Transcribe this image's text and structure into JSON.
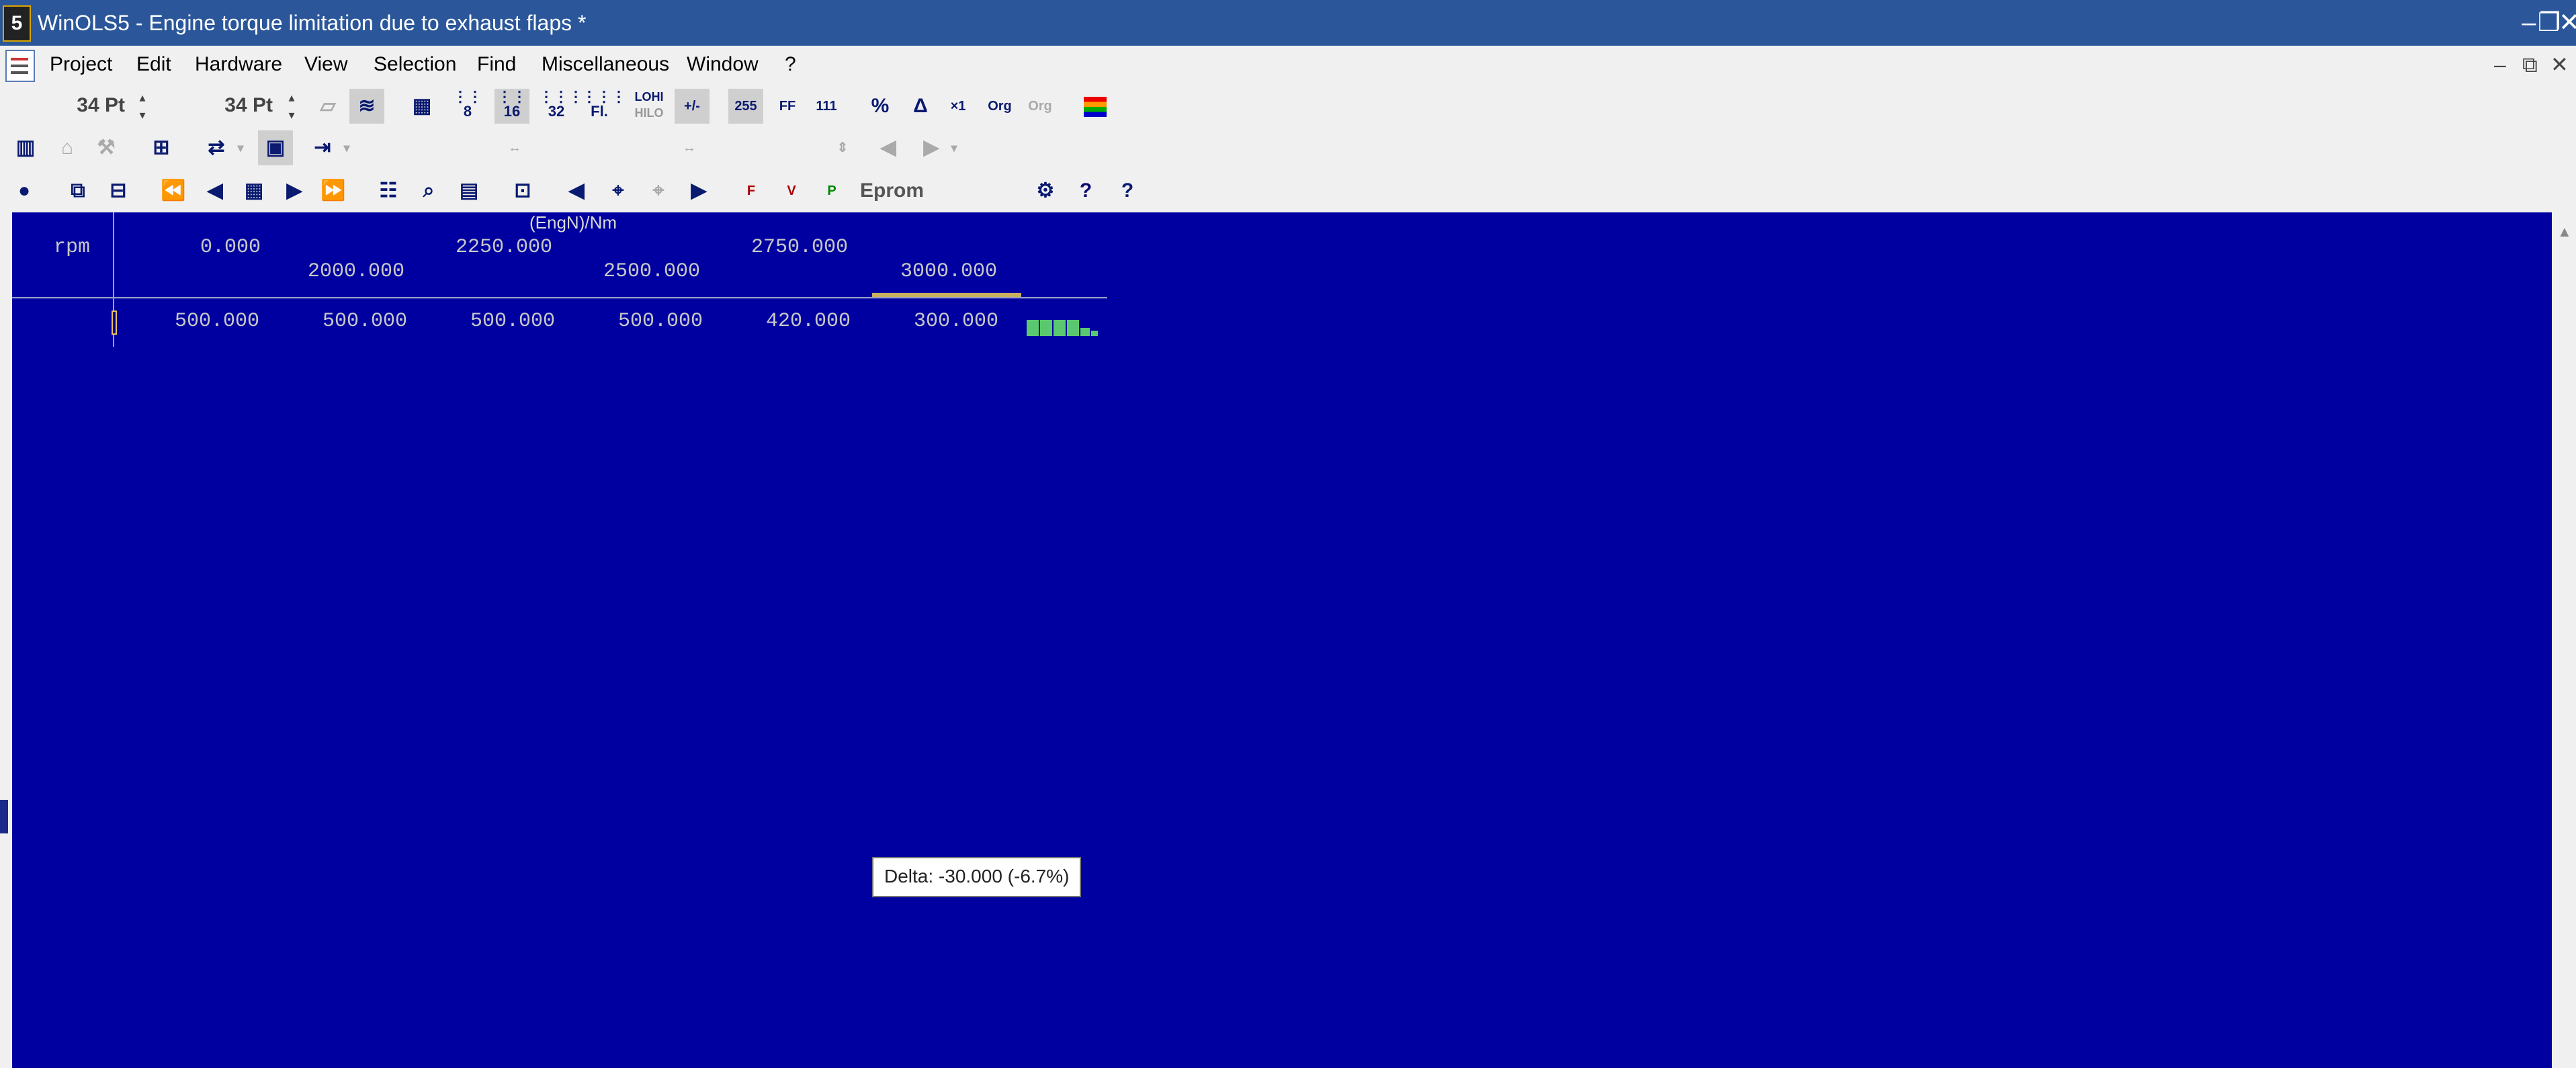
{
  "window": {
    "app_icon_glyph": "5",
    "title": "WinOLS5 - Engine torque limitation due to exhaust flaps *",
    "controls": [
      "–",
      "❐",
      "✕"
    ]
  },
  "menu": {
    "items": [
      "Project",
      "Edit",
      "Hardware",
      "View",
      "Selection",
      "Find",
      "Miscellaneous",
      "Window",
      "?"
    ],
    "mdi_controls": [
      "–",
      "⧉",
      "✕"
    ]
  },
  "toolbar1": {
    "font_size_1": "34 Pt",
    "font_size_2": "34 Pt",
    "btn_8": "8",
    "btn_16": "16",
    "btn_32": "32",
    "btn_fl": "Fl.",
    "btn_lohi": "LOHI",
    "btn_hilo": "HILO",
    "btn_plusminus": "+/-",
    "btn_255": "255",
    "btn_ff": "FF",
    "btn_111": "111",
    "btn_percent": "%",
    "btn_delta": "Δ",
    "btn_x1": "×1",
    "btn_org": "Org",
    "btn_org_org": "Org"
  },
  "toolbar3": {
    "btn_f": "F",
    "btn_v": "V",
    "btn_p": "P",
    "eprom_label": "Eprom",
    "help_glyph": "?",
    "context_help_glyph": "?"
  },
  "map": {
    "axis_unit": "(EngN)/Nm",
    "row_label": "rpm",
    "x_axis_upper": [
      "0.000",
      "2250.000",
      "2750.000"
    ],
    "x_axis_lower": [
      "2000.000",
      "2500.000",
      "3000.000"
    ],
    "values": [
      "500.000",
      "500.000",
      "500.000",
      "500.000",
      "420.000",
      "300.000"
    ]
  },
  "tooltip": {
    "text": "Delta: -30.000 (-6.7%)"
  },
  "colors": {
    "titlebar": "#2b579a",
    "editor_bg": "#0000a0",
    "text": "#c8c8c8",
    "selection": "#c8b060",
    "histogram": "#5ac870"
  }
}
